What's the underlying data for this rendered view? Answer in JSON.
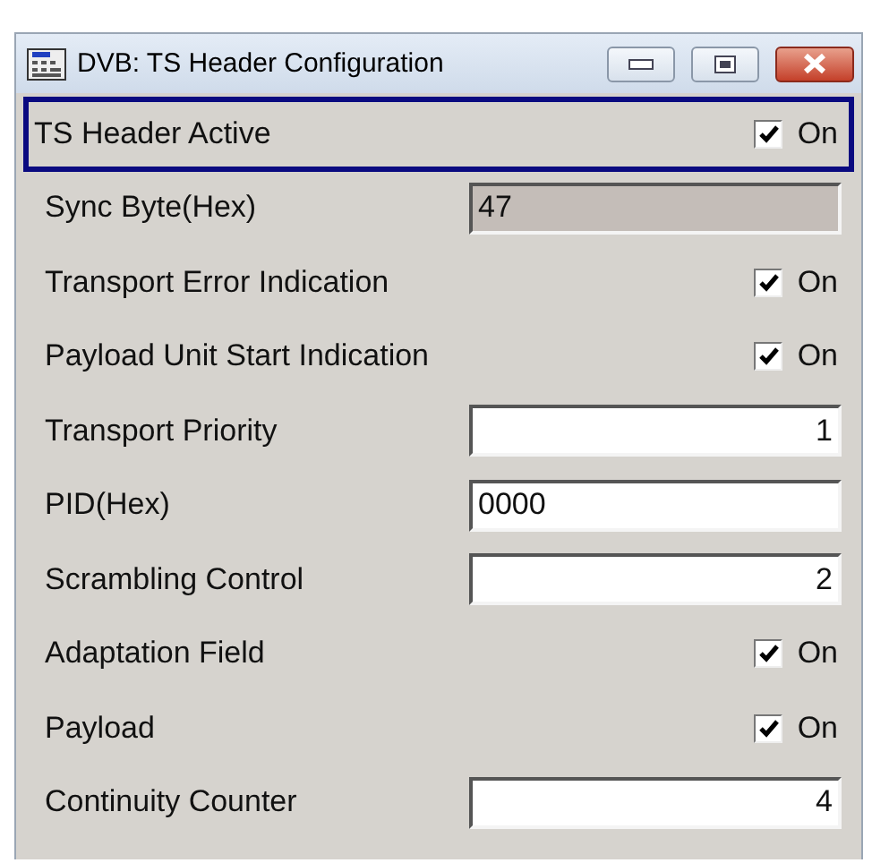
{
  "window": {
    "title": "DVB: TS Header Configuration"
  },
  "rows": [
    {
      "kind": "checkbox",
      "label": "TS Header Active",
      "checked": true,
      "option": "On",
      "focused": true
    },
    {
      "kind": "text_field",
      "label": "Sync Byte(Hex)",
      "value": "47",
      "disabled": true,
      "focused": false
    },
    {
      "kind": "checkbox",
      "label": "Transport Error Indication",
      "checked": true,
      "option": "On",
      "focused": false
    },
    {
      "kind": "checkbox",
      "label": "Payload Unit Start Indication",
      "checked": true,
      "option": "On",
      "focused": false
    },
    {
      "kind": "number_field",
      "label": "Transport Priority",
      "value": "1",
      "disabled": false,
      "focused": false
    },
    {
      "kind": "text_field",
      "label": "PID(Hex)",
      "value": "0000",
      "disabled": false,
      "focused": false
    },
    {
      "kind": "number_field",
      "label": "Scrambling Control",
      "value": "2",
      "disabled": false,
      "focused": false
    },
    {
      "kind": "checkbox",
      "label": "Adaptation Field",
      "checked": true,
      "option": "On",
      "focused": false
    },
    {
      "kind": "checkbox",
      "label": "Payload",
      "checked": true,
      "option": "On",
      "focused": false
    },
    {
      "kind": "number_field",
      "label": "Continuity Counter",
      "value": "4",
      "disabled": false,
      "focused": false
    }
  ]
}
